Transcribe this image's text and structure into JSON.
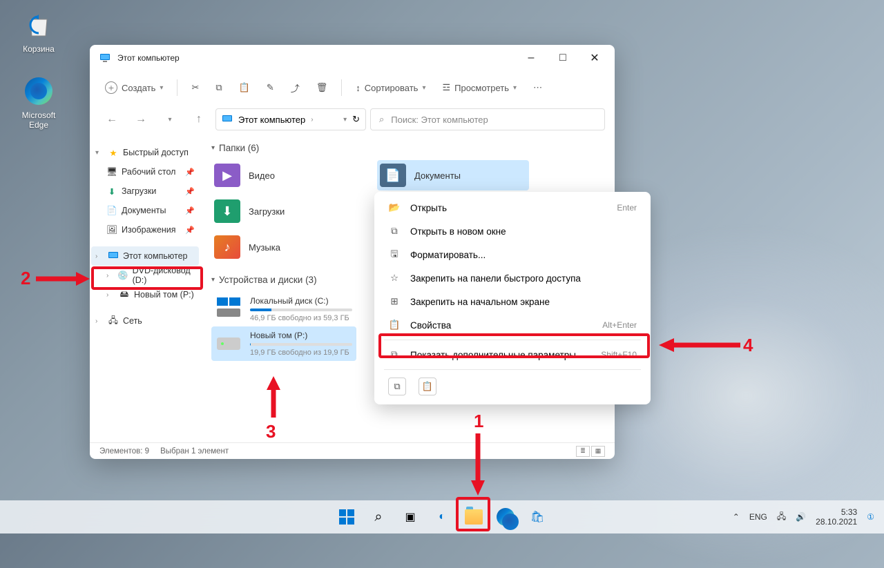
{
  "desktop": {
    "recycle": "Корзина",
    "edge": "Microsoft Edge"
  },
  "window": {
    "title": "Этот компьютер",
    "toolbar": {
      "create": "Создать",
      "sort": "Сортировать",
      "view": "Просмотреть"
    },
    "breadcrumb": "Этот компьютер",
    "search_placeholder": "Поиск: Этот компьютер",
    "status_count": "Элементов: 9",
    "status_selected": "Выбран 1 элемент"
  },
  "sidebar": {
    "quick_access": "Быстрый доступ",
    "desktop": "Рабочий стол",
    "downloads": "Загрузки",
    "documents": "Документы",
    "pictures": "Изображения",
    "this_pc": "Этот компьютер",
    "dvd": "DVD-дисковод (D:)",
    "new_vol": "Новый том (P:)",
    "network": "Сеть"
  },
  "main": {
    "folders_header": "Папки (6)",
    "devices_header": "Устройства и диски (3)",
    "video": "Видео",
    "documents": "Документы",
    "downloads": "Загрузки",
    "music": "Музыка",
    "drive_c": {
      "name": "Локальный диск (C:)",
      "stats": "46,9 ГБ свободно из 59,3 ГБ",
      "fill": 21
    },
    "drive_p": {
      "name": "Новый том (P:)",
      "stats": "19,9 ГБ свободно из 19,9 ГБ",
      "fill": 1
    }
  },
  "context_menu": {
    "open": {
      "label": "Открыть",
      "shortcut": "Enter"
    },
    "open_new": "Открыть в новом окне",
    "format": "Форматировать...",
    "pin_quick": "Закрепить на панели быстрого доступа",
    "pin_start": "Закрепить на начальном экране",
    "properties": {
      "label": "Свойства",
      "shortcut": "Alt+Enter"
    },
    "more": {
      "label": "Показать дополнительные параметры",
      "shortcut": "Shift+F10"
    }
  },
  "taskbar": {
    "lang": "ENG",
    "time": "5:33",
    "date": "28.10.2021"
  },
  "annotations": {
    "n1": "1",
    "n2": "2",
    "n3": "3",
    "n4": "4"
  }
}
